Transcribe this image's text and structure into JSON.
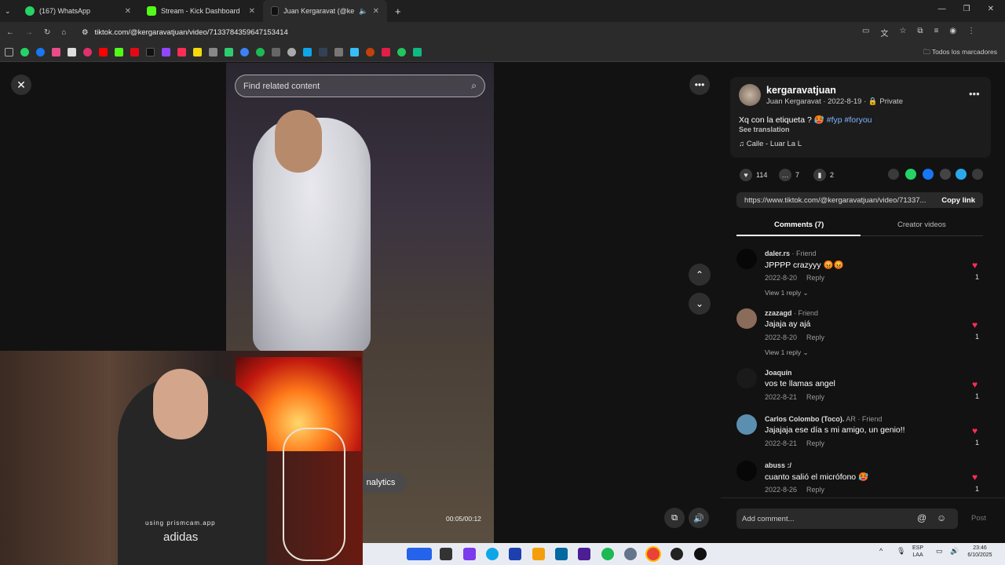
{
  "browser": {
    "tabs": [
      {
        "title": "(167) WhatsApp",
        "color": "#25d366"
      },
      {
        "title": "Stream - Kick Dashboard",
        "color": "#53fc18"
      },
      {
        "title": "Juan Kergaravat (@kergara",
        "color": "#111111"
      }
    ],
    "url": "tiktok.com/@kergaravatjuan/video/7133784359647153414",
    "all_bookmarks": "Todos los marcadores"
  },
  "video": {
    "search_placeholder": "Find related content",
    "time": "00:05/00:12",
    "analytics_label": "nalytics"
  },
  "overlay": {
    "watermark": "using prismcam.app",
    "shirt_text": "adidas"
  },
  "post": {
    "username": "kergaravatjuan",
    "meta": "Juan Kergaravat · 2022-8-19 ·",
    "privacy": "Private",
    "caption_text": "Xq con la etiqueta ? 🥵",
    "hashtags": "#fyp #foryou",
    "see_translation": "See translation",
    "music": "Calle - Luar La L",
    "likes": "114",
    "comments_count": "7",
    "saves": "2",
    "link": "https://www.tiktok.com/@kergaravatjuan/video/71337...",
    "copy_link": "Copy link"
  },
  "tabs": {
    "comments": "Comments (7)",
    "creator_videos": "Creator videos"
  },
  "comments": [
    {
      "user": "daler.rs",
      "tag": " · Friend",
      "text": "JPPPP crazyyy 😡😡",
      "date": "2022-8-20",
      "reply": "Reply",
      "likes": "1",
      "view_replies": "View 1 reply"
    },
    {
      "user": "zzazagd",
      "tag": " · Friend",
      "text": "Jajaja ay ajá",
      "date": "2022-8-20",
      "reply": "Reply",
      "likes": "1",
      "view_replies": "View 1 reply"
    },
    {
      "user": "Joaquín",
      "tag": "",
      "text": "vos te llamas angel",
      "date": "2022-8-21",
      "reply": "Reply",
      "likes": "1",
      "view_replies": ""
    },
    {
      "user": "Carlos Colombo (Toco).",
      "tag": " AR · Friend",
      "text": "Jajajaja ese día s mi amigo, un genio!!",
      "date": "2022-8-21",
      "reply": "Reply",
      "likes": "1",
      "view_replies": ""
    },
    {
      "user": "abuss :/",
      "tag": "",
      "text": "cuanto salió el micrófono 🥵",
      "date": "2022-8-26",
      "reply": "Reply",
      "likes": "1",
      "view_replies": ""
    }
  ],
  "composer": {
    "placeholder": "Add comment...",
    "post": "Post"
  },
  "taskbar": {
    "lang_top": "ESP",
    "lang_bottom": "LAA",
    "clock": "23:46",
    "date": "6/10/2025"
  }
}
